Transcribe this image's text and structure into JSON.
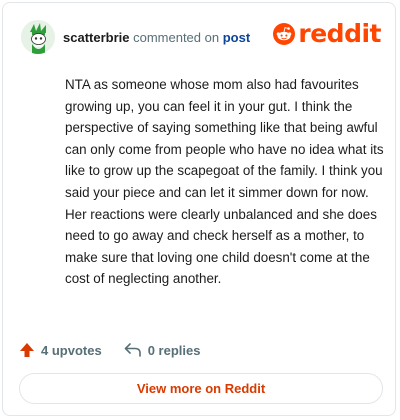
{
  "header": {
    "username": "scatterbrie",
    "commented_on": " commented on ",
    "post_link": "post"
  },
  "logo": {
    "wordmark": "reddit",
    "brand_color": "#ff4500"
  },
  "comment": {
    "body": "NTA as someone whose mom also had favourites growing up, you can feel it in your gut. I think the perspective of saying something like that being awful can only come from people who have no idea what its like to grow up the scapegoat of the family. I think you said your piece and can let it simmer down for now. Her reactions were clearly unbalanced and she does need to go away and check herself as a mother, to make sure that loving one child doesn't come at the cost of neglecting another."
  },
  "actions": {
    "upvotes_label": "4 upvotes",
    "replies_label": "0 replies",
    "upvote_icon": "upvote-arrow-icon",
    "reply_icon": "reply-arrow-icon"
  },
  "footer": {
    "view_more_label": "View more on Reddit"
  },
  "colors": {
    "accent": "#d93a00",
    "text_muted": "#576f76",
    "link": "#0a449b"
  }
}
